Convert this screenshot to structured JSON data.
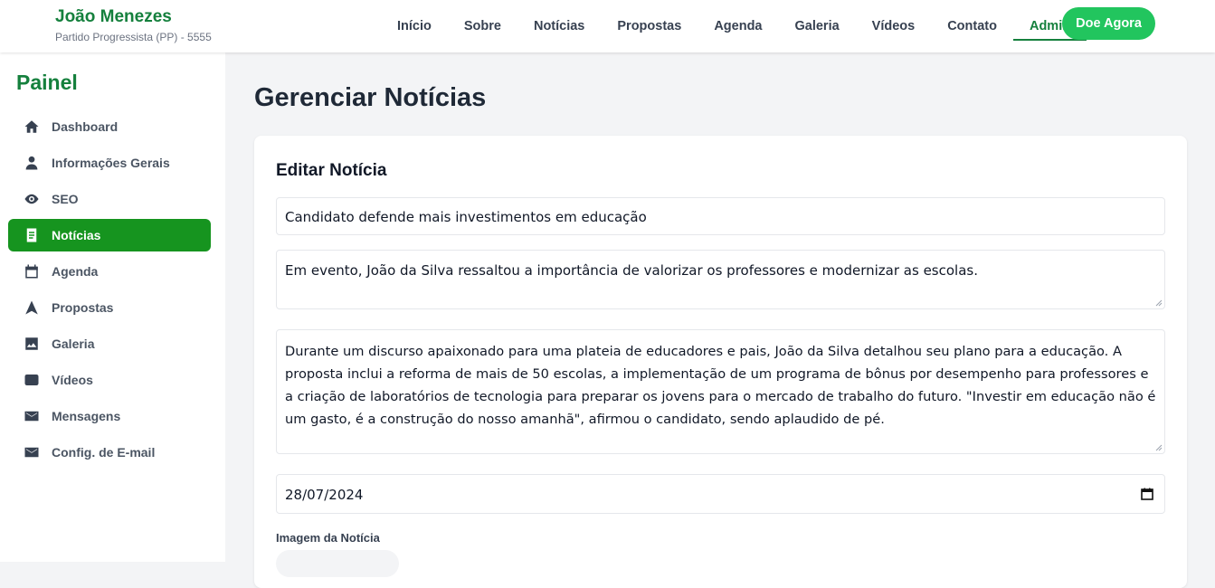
{
  "header": {
    "name": "João Menezes",
    "party": "Partido Progressista (PP) - 5555",
    "nav": [
      "Início",
      "Sobre",
      "Notícias",
      "Propostas",
      "Agenda",
      "Galeria",
      "Vídeos",
      "Contato",
      "Admin"
    ],
    "active_nav": "Admin",
    "donate_label": "Doe Agora",
    "accent_color": "#15803d",
    "donate_color": "#22c55e"
  },
  "sidebar": {
    "title": "Painel",
    "items": [
      {
        "label": "Dashboard",
        "icon": "home-icon"
      },
      {
        "label": "Informações Gerais",
        "icon": "user-icon"
      },
      {
        "label": "SEO",
        "icon": "eye-icon"
      },
      {
        "label": "Notícias",
        "icon": "document-icon"
      },
      {
        "label": "Agenda",
        "icon": "calendar-icon"
      },
      {
        "label": "Propostas",
        "icon": "triangle-icon"
      },
      {
        "label": "Galeria",
        "icon": "image-icon"
      },
      {
        "label": "Vídeos",
        "icon": "video-icon"
      },
      {
        "label": "Mensagens",
        "icon": "mail-icon"
      },
      {
        "label": "Config. de E-mail",
        "icon": "mail-settings-icon"
      }
    ],
    "active_item": "Notícias",
    "active_color": "#16941f"
  },
  "main": {
    "page_title": "Gerenciar Notícias",
    "form": {
      "title": "Editar Notícia",
      "headline": "Candidato defende mais investimentos em educação",
      "summary": "Em evento, João da Silva ressaltou a importância de valorizar os professores e modernizar as escolas.",
      "body": "Durante um discurso apaixonado para uma plateia de educadores e pais, João da Silva detalhou seu plano para a educação. A proposta inclui a reforma de mais de 50 escolas, a implementação de um programa de bônus por desempenho para professores e a criação de laboratórios de tecnologia para preparar os jovens para o mercado de trabalho do futuro. \"Investir em educação não é um gasto, é a construção do nosso amanhã\", afirmou o candidato, sendo aplaudido de pé.",
      "date": "28/07/2024",
      "image_label": "Imagem da Notícia"
    }
  }
}
